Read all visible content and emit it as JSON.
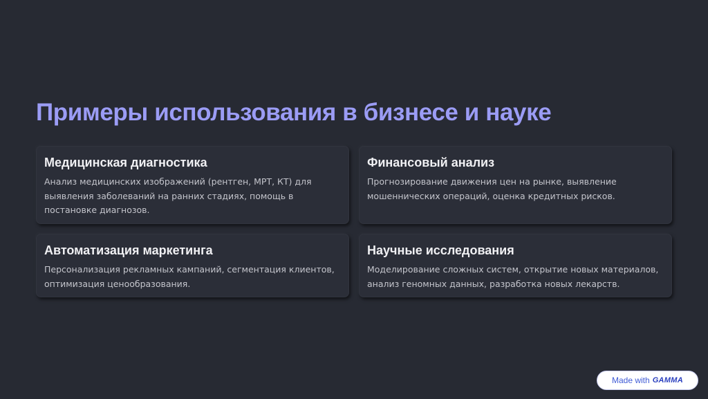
{
  "slide": {
    "title": "Примеры использования в бизнесе и науке",
    "cards": [
      {
        "title": "Медицинская диагностика",
        "text": "Анализ медицинских изображений (рентген, МРТ, КТ) для выявления заболеваний на ранних стадиях, помощь в постановке диагнозов."
      },
      {
        "title": "Финансовый анализ",
        "text": "Прогнозирование движения цен на рынке, выявление мошеннических операций, оценка кредитных рисков."
      },
      {
        "title": "Автоматизация маркетинга",
        "text": "Персонализация рекламных кампаний, сегментация клиентов, оптимизация ценообразования."
      },
      {
        "title": "Научные исследования",
        "text": "Моделирование сложных систем, открытие новых материалов, анализ геномных данных, разработка новых лекарств."
      }
    ]
  },
  "badge": {
    "label": "Made with",
    "brand": "GAMMA"
  },
  "colors": {
    "background": "#272a33",
    "title": "#9b9cf5",
    "card": "#2b2e38",
    "badge_text": "#3f5bd6"
  }
}
